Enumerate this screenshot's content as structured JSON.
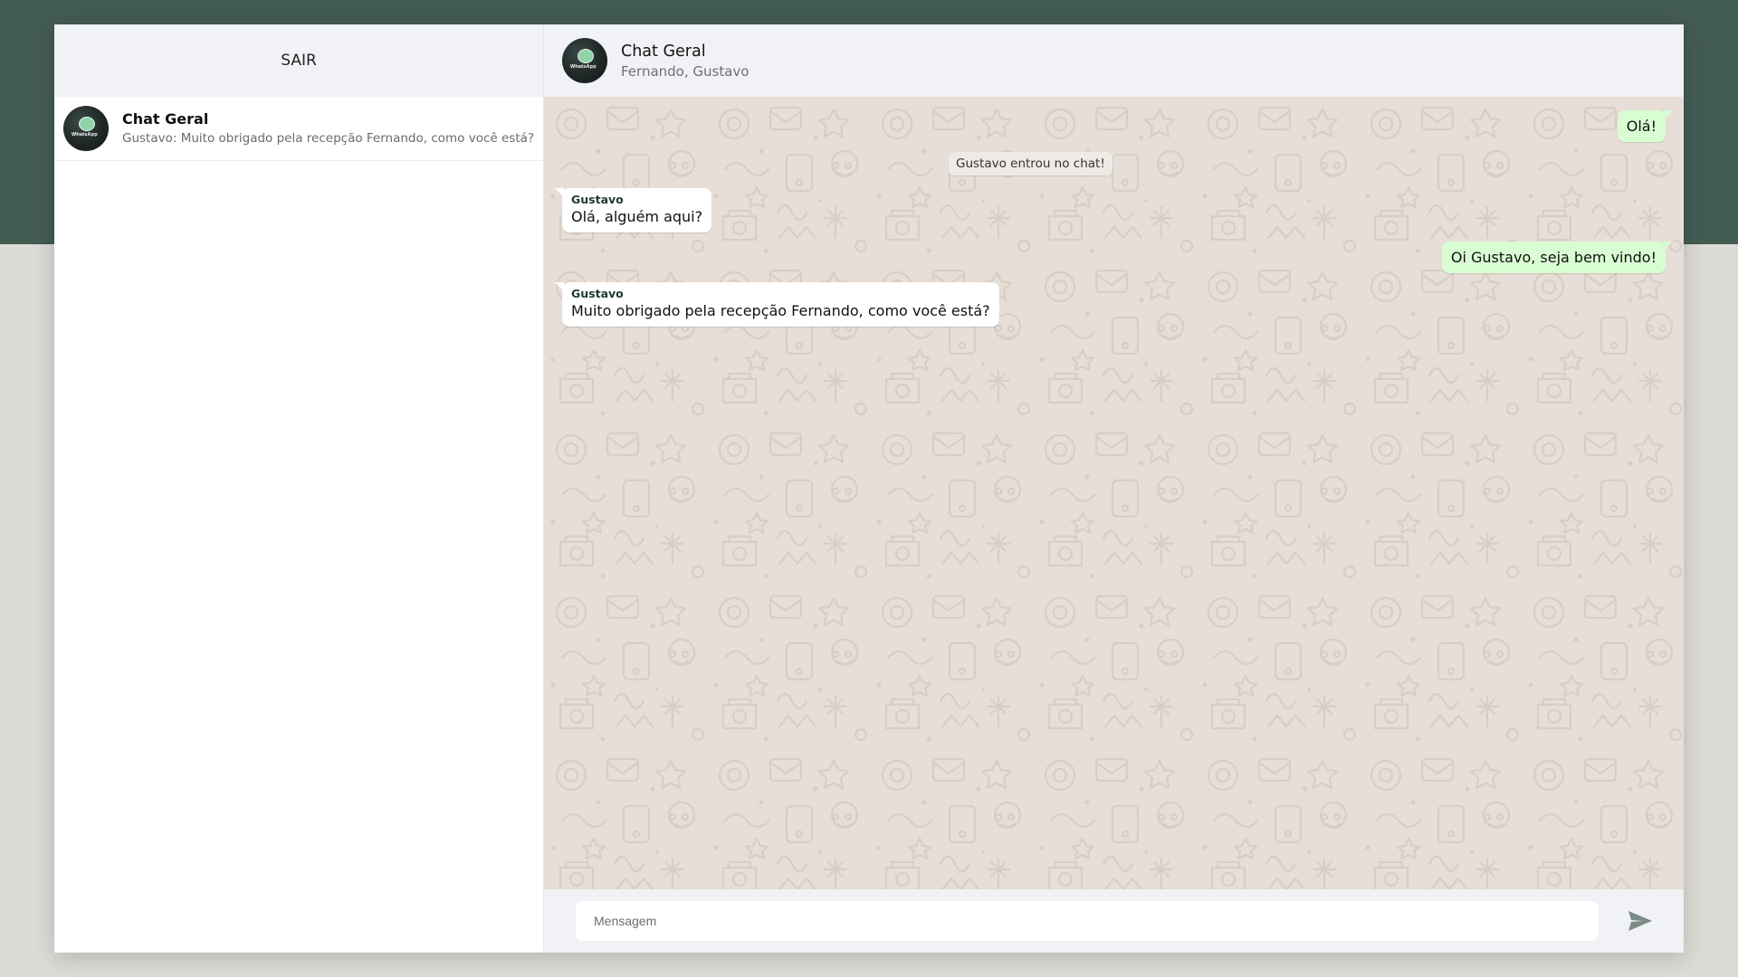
{
  "sidebar": {
    "logout_label": "SAIR",
    "chats": [
      {
        "title": "Chat Geral",
        "preview": "Gustavo: Muito obrigado pela recepção Fernando, como você está?",
        "avatar_icon": "whatsapp-logo-avatar"
      }
    ]
  },
  "chat_header": {
    "title": "Chat Geral",
    "participants": "Fernando, Gustavo",
    "avatar_icon": "whatsapp-logo-avatar"
  },
  "messages": [
    {
      "direction": "out",
      "text": "Olá!"
    },
    {
      "direction": "system",
      "text": "Gustavo entrou no chat!"
    },
    {
      "direction": "in",
      "sender": "Gustavo",
      "text": "Olá, alguém aqui?"
    },
    {
      "direction": "out",
      "text": "Oi Gustavo, seja bem vindo!"
    },
    {
      "direction": "in",
      "sender": "Gustavo",
      "text": "Muito obrigado pela recepção Fernando, como você está?"
    }
  ],
  "composer": {
    "placeholder": "Mensagem",
    "value": "",
    "send_icon": "send-icon"
  },
  "colors": {
    "top_band": "#435c53",
    "page_background": "#dddbd6",
    "panel_header": "#f0f2f5",
    "chat_wallpaper": "#e6ded7",
    "outgoing_bubble": "#d9fdd3",
    "incoming_bubble": "#ffffff",
    "sender_name": "#1e3a30"
  }
}
